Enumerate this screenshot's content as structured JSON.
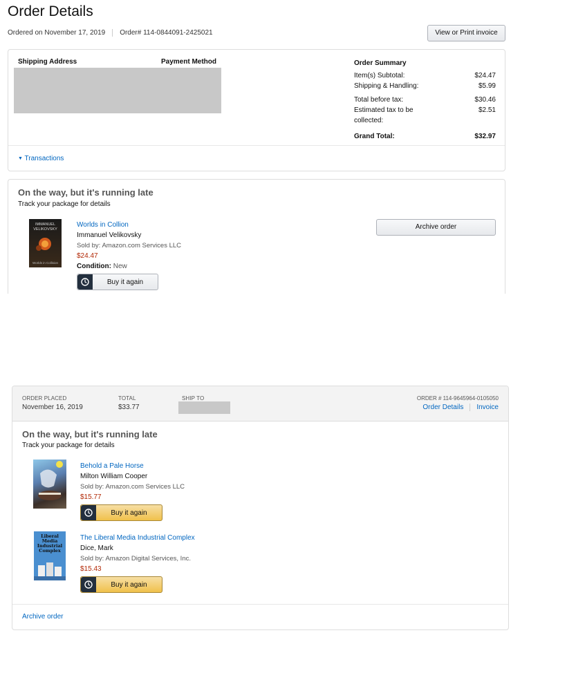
{
  "header": {
    "title": "Order Details",
    "ordered_on": "Ordered on November 17, 2019",
    "order_number": "Order# 114-0844091-2425021",
    "invoice_button": "View or Print invoice"
  },
  "summary": {
    "shipping_address_label": "Shipping Address",
    "payment_method_label": "Payment Method",
    "order_summary_label": "Order Summary",
    "rows": [
      {
        "label": "Item(s) Subtotal:",
        "value": "$24.47"
      },
      {
        "label": "Shipping & Handling:",
        "value": "$5.99"
      },
      {
        "label": "Total before tax:",
        "value": "$30.46"
      },
      {
        "label": "Estimated tax to be collected:",
        "value": "$2.51"
      },
      {
        "label": "Grand Total:",
        "value": "$32.97"
      }
    ],
    "transactions_link": "Transactions"
  },
  "shipment": {
    "status": "On the way, but it's running late",
    "status_sub": "Track your package for details",
    "item": {
      "cover_text_1": "IMMANUEL VELIKOVSKY",
      "cover_text_2": "Worlds in Collision",
      "title": "Worlds in Collion",
      "author": "Immanuel Velikovsky",
      "sold_by": "Sold by: Amazon.com Services LLC",
      "price": "$24.47",
      "condition_label": "Condition:",
      "condition_value": "New",
      "buy_again": "Buy it again"
    },
    "archive_button": "Archive order"
  },
  "second_order": {
    "order_placed_label": "ORDER PLACED",
    "order_placed_value": "November 16, 2019",
    "total_label": "TOTAL",
    "total_value": "$33.77",
    "ship_to_label": "SHIP TO",
    "order_number": "ORDER # 114-9645964-0105050",
    "order_details_link": "Order Details",
    "invoice_link": "Invoice",
    "status": "On the way, but it's running late",
    "status_sub": "Track your package for details",
    "items": [
      {
        "title": "Behold a Pale Horse",
        "author": "Milton William Cooper",
        "sold_by": "Sold by: Amazon.com Services LLC",
        "price": "$15.77",
        "buy_again": "Buy it again"
      },
      {
        "cover_text": "Liberal Media Industrial Complex",
        "title": "The Liberal Media Industrial Complex",
        "author": "Dice, Mark",
        "sold_by": "Sold by: Amazon Digital Services, Inc.",
        "price": "$15.43",
        "buy_again": "Buy it again"
      }
    ],
    "archive_link": "Archive order"
  },
  "colors": {
    "link": "#0066c0",
    "price": "#b12704",
    "gold_button": "#f0c14b"
  }
}
